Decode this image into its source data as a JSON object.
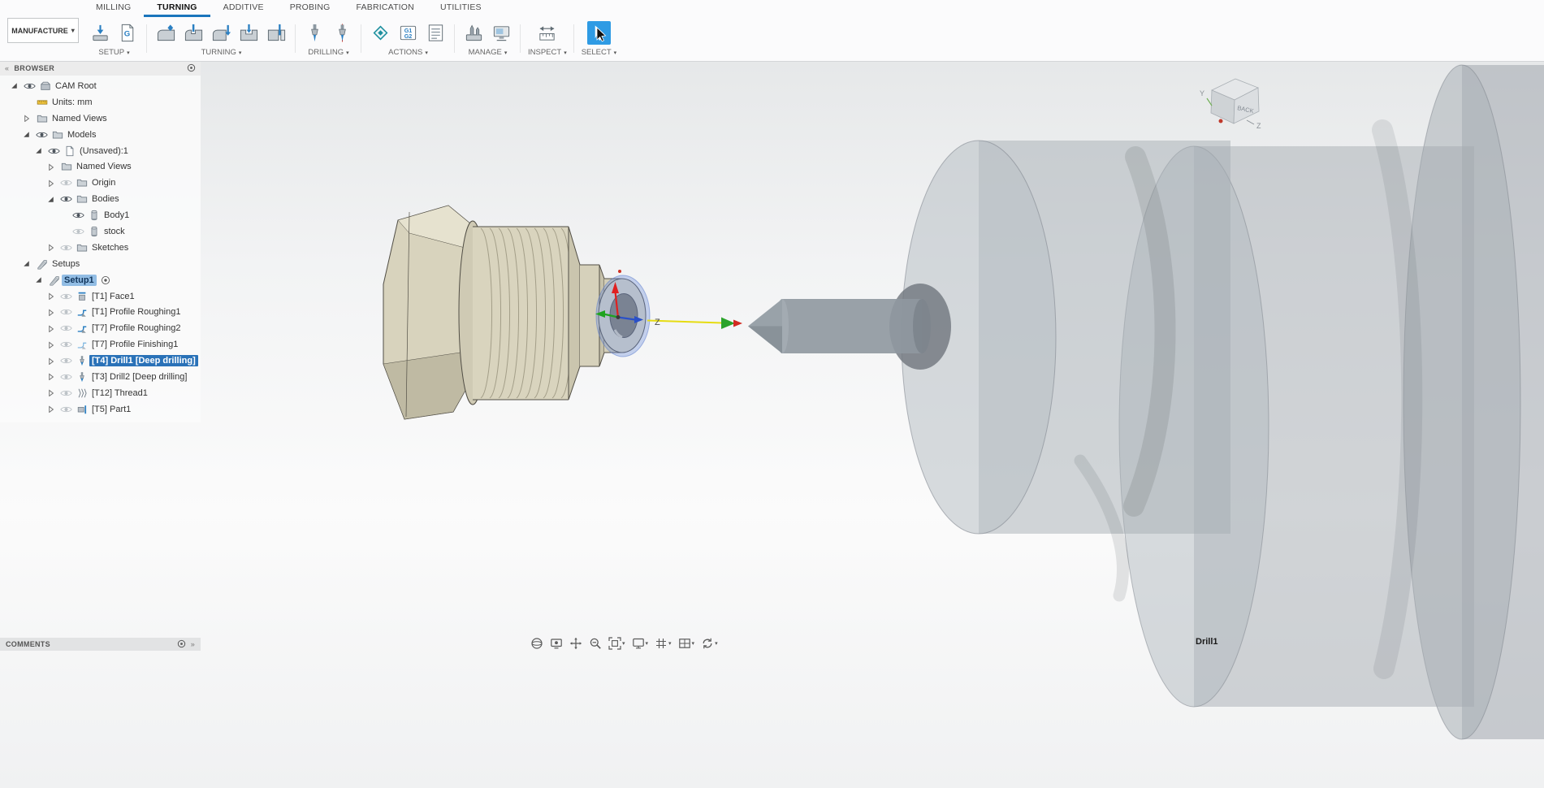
{
  "workspace": {
    "label": "MANUFACTURE"
  },
  "tabs": [
    {
      "label": "MILLING",
      "active": false
    },
    {
      "label": "TURNING",
      "active": true
    },
    {
      "label": "ADDITIVE",
      "active": false
    },
    {
      "label": "PROBING",
      "active": false
    },
    {
      "label": "FABRICATION",
      "active": false
    },
    {
      "label": "UTILITIES",
      "active": false
    }
  ],
  "ribbon_groups": [
    {
      "id": "setup",
      "label": "SETUP",
      "items": [
        {
          "icon": "new-setup"
        },
        {
          "icon": "gcode-document"
        }
      ]
    },
    {
      "id": "turning",
      "label": "TURNING",
      "items": [
        {
          "icon": "turn-profile"
        },
        {
          "icon": "turn-groove"
        },
        {
          "icon": "turn-face"
        },
        {
          "icon": "turn-single-groove"
        },
        {
          "icon": "turn-part"
        }
      ]
    },
    {
      "id": "drilling",
      "label": "DRILLING",
      "items": [
        {
          "icon": "drill"
        },
        {
          "icon": "drill-deep"
        }
      ]
    },
    {
      "id": "actions",
      "label": "ACTIONS",
      "items": [
        {
          "icon": "simulate"
        },
        {
          "icon": "post-process"
        },
        {
          "icon": "setup-sheet"
        }
      ]
    },
    {
      "id": "manage",
      "label": "MANAGE",
      "items": [
        {
          "icon": "tool-library"
        },
        {
          "icon": "machine-library"
        }
      ]
    },
    {
      "id": "inspect",
      "label": "INSPECT",
      "items": [
        {
          "icon": "measure"
        }
      ]
    },
    {
      "id": "select",
      "label": "SELECT",
      "items": [
        {
          "icon": "select-cursor",
          "active": true
        }
      ]
    }
  ],
  "browser": {
    "title": "BROWSER",
    "rows": [
      {
        "label": "CAM Root",
        "level": 0,
        "arrow": "expanded",
        "eye": "visible",
        "icon": "cam-root",
        "selected": "none"
      },
      {
        "label": "Units: mm",
        "level": 1,
        "arrow": "none",
        "eye": "none",
        "icon": "units",
        "selected": "none"
      },
      {
        "label": "Named Views",
        "level": 1,
        "arrow": "collapsed",
        "eye": "none",
        "icon": "folder",
        "selected": "none"
      },
      {
        "label": "Models",
        "level": 1,
        "arrow": "expanded",
        "eye": "visible",
        "icon": "folder",
        "selected": "none"
      },
      {
        "label": "(Unsaved):1",
        "level": 2,
        "arrow": "expanded",
        "eye": "visible",
        "icon": "document",
        "selected": "none"
      },
      {
        "label": "Named Views",
        "level": 3,
        "arrow": "collapsed",
        "eye": "none",
        "icon": "folder",
        "selected": "none"
      },
      {
        "label": "Origin",
        "level": 3,
        "arrow": "collapsed",
        "eye": "hidden",
        "icon": "folder",
        "selected": "none"
      },
      {
        "label": "Bodies",
        "level": 3,
        "arrow": "expanded",
        "eye": "visible",
        "icon": "folder",
        "selected": "none"
      },
      {
        "label": "Body1",
        "level": 4,
        "arrow": "none",
        "eye": "visible",
        "icon": "body",
        "selected": "none"
      },
      {
        "label": "stock",
        "level": 4,
        "arrow": "none",
        "eye": "hidden",
        "icon": "body",
        "selected": "none"
      },
      {
        "label": "Sketches",
        "level": 3,
        "arrow": "collapsed",
        "eye": "hidden",
        "icon": "folder",
        "selected": "none"
      },
      {
        "label": "Setups",
        "level": 1,
        "arrow": "expanded",
        "eye": "none",
        "icon": "setup",
        "selected": "none"
      },
      {
        "label": "Setup1",
        "level": 2,
        "arrow": "expanded",
        "eye": "none",
        "icon": "setup",
        "selected": "setup",
        "trailing": "radio"
      },
      {
        "label": "[T1] Face1",
        "level": 3,
        "arrow": "collapsed",
        "eye": "hidden",
        "icon": "op-face",
        "selected": "none"
      },
      {
        "label": "[T1] Profile Roughing1",
        "level": 3,
        "arrow": "collapsed",
        "eye": "hidden",
        "icon": "op-profile",
        "selected": "none"
      },
      {
        "label": "[T7] Profile Roughing2",
        "level": 3,
        "arrow": "collapsed",
        "eye": "hidden",
        "icon": "op-profile",
        "selected": "none"
      },
      {
        "label": "[T7] Profile Finishing1",
        "level": 3,
        "arrow": "collapsed",
        "eye": "hidden",
        "icon": "op-finish",
        "selected": "none"
      },
      {
        "label": "[T4] Drill1 [Deep drilling]",
        "level": 3,
        "arrow": "collapsed",
        "eye": "hidden",
        "icon": "op-drill",
        "selected": "operation"
      },
      {
        "label": "[T3] Drill2 [Deep drilling]",
        "level": 3,
        "arrow": "collapsed",
        "eye": "hidden",
        "icon": "op-drill",
        "selected": "none"
      },
      {
        "label": "[T12] Thread1",
        "level": 3,
        "arrow": "collapsed",
        "eye": "hidden",
        "icon": "op-thread",
        "selected": "none"
      },
      {
        "label": "[T5] Part1",
        "level": 3,
        "arrow": "collapsed",
        "eye": "hidden",
        "icon": "op-part",
        "selected": "none"
      }
    ]
  },
  "comments": {
    "title": "COMMENTS"
  },
  "navbar": [
    {
      "icon": "orbit",
      "caret": false
    },
    {
      "icon": "look-at",
      "caret": false
    },
    {
      "icon": "pan",
      "caret": false
    },
    {
      "icon": "zoom",
      "caret": false
    },
    {
      "icon": "fit",
      "caret": true
    },
    {
      "icon": "display-settings",
      "caret": true
    },
    {
      "icon": "grid-and-snaps",
      "caret": true
    },
    {
      "icon": "viewports",
      "caret": true
    },
    {
      "icon": "refresh",
      "caret": true
    }
  ],
  "status": {
    "current_operation": "Drill1"
  },
  "viewcube": {
    "face_label": "BACK",
    "axis_y": "Y",
    "axis_z": "Z"
  },
  "scene": {
    "axis_z_label": "Z"
  },
  "colors": {
    "tab_accent": "#1a75bc",
    "operation_selection": "#2a72b8",
    "setup_selection": "#92bde4",
    "select_button_bg": "#2f9be4",
    "part_beige": "#d9d4be",
    "stock_gray": "#a7aeb4",
    "axis_red": "#e02020",
    "axis_green": "#1fa31f",
    "axis_blue": "#2a50c8",
    "rapid_yellow": "#e6dc12"
  }
}
